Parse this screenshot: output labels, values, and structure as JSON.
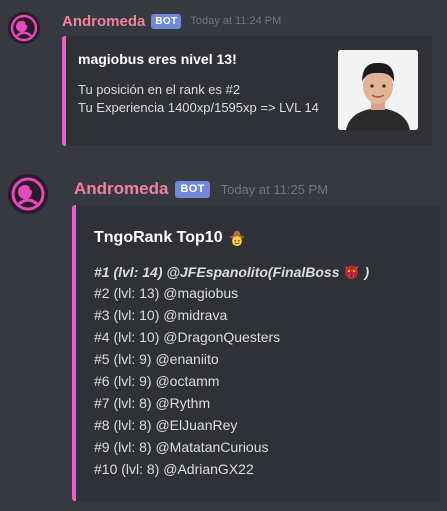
{
  "messages": [
    {
      "author": "Andromeda",
      "bot_tag": "BOT",
      "timestamp": "Today at 11:24 PM",
      "embed": {
        "title": "magiobus eres nivel 13!",
        "lines": [
          "Tu posición en el rank es #2",
          "Tu Experiencia 1400xp/1595xp => LVL 14"
        ]
      }
    },
    {
      "author": "Andromeda",
      "bot_tag": "BOT",
      "timestamp": "Today at 11:25 PM",
      "embed": {
        "title": "TngoRank Top10",
        "title_emoji": "cowboy-emoji",
        "first_line": "#1 (lvl: 14) @JFEspanolito(FinalBoss",
        "first_line_emoji": "ogre-emoji",
        "first_line_end": ")",
        "lines": [
          "#2 (lvl: 13) @magiobus",
          "#3 (lvl: 10) @midrava",
          "#4 (lvl: 10) @DragonQuesters",
          "#5 (lvl: 9) @enaniito",
          "#6 (lvl: 9) @octamm",
          "#7 (lvl: 8) @Rythm",
          "#8 (lvl: 8) @ElJuanRey",
          "#9 (lvl: 8) @MatatanCurious",
          "#10 (lvl: 8) @AdrianGX22"
        ]
      }
    }
  ],
  "colors": {
    "background": "#36393f",
    "embed_bg": "#2f3136",
    "embed_border": "#ea5fd0",
    "username": "#f47fa1",
    "bot_tag": "#7289da",
    "timestamp": "#72767d"
  },
  "icons": {
    "close": "close-icon"
  }
}
